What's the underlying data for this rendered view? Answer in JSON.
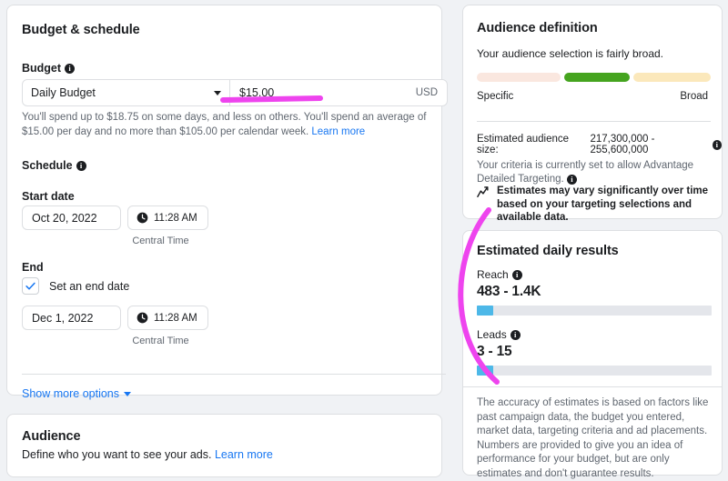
{
  "budget_card": {
    "title": "Budget & schedule",
    "budget_label": "Budget",
    "budget_type": "Daily Budget",
    "budget_amount": "$15.00",
    "currency": "USD",
    "help_text": "You'll spend up to $18.75 on some days, and less on others. You'll spend an average of $15.00 per day and no more than $105.00 per calendar week. ",
    "help_link": "Learn more",
    "schedule_label": "Schedule",
    "start_date_label": "Start date",
    "start_date": "Oct 20, 2022",
    "start_time": "11:28 AM",
    "start_timezone": "Central Time",
    "end_label": "End",
    "end_checkbox_label": "Set an end date",
    "end_checkbox_checked": true,
    "end_date": "Dec 1, 2022",
    "end_time": "11:28 AM",
    "end_timezone": "Central Time",
    "show_more_options": "Show more options"
  },
  "audience_card": {
    "title": "Audience",
    "subtitle": "Define who you want to see your ads. ",
    "link": "Learn more"
  },
  "audience_definition": {
    "title": "Audience definition",
    "subtitle": "Your audience selection is fairly broad.",
    "gauge_specific_label": "Specific",
    "gauge_broad_label": "Broad",
    "gauge_segments": [
      {
        "name": "specific",
        "color": "#fae7df",
        "width_pct": 37
      },
      {
        "name": "selected",
        "color": "#45a41f",
        "width_pct": 29
      },
      {
        "name": "broad",
        "color": "#fbe8bb",
        "width_pct": 34
      }
    ],
    "estimated_size_label": "Estimated audience size:",
    "estimated_size_value": "217,300,000 - 255,600,000",
    "criteria_note": "Your criteria is currently set to allow Advantage Detailed Targeting.",
    "estimates_note": "Estimates may vary significantly over time based on your targeting selections and available data."
  },
  "estimated_results": {
    "title": "Estimated daily results",
    "metrics": [
      {
        "label": "Reach",
        "value": "483 - 1.4K",
        "bar_pct": 7
      },
      {
        "label": "Leads",
        "value": "3 - 15",
        "bar_pct": 7
      }
    ],
    "note": "The accuracy of estimates is based on factors like past campaign data, the budget you entered, market data, targeting criteria and ad placements. Numbers are provided to give you an idea of performance for your budget, but are only estimates and don't guarantee results."
  },
  "annotations": {
    "highlight_color": "#ee44ee",
    "items": [
      {
        "name": "budget-amount-underline",
        "type": "line"
      },
      {
        "name": "estimated-results-arc",
        "type": "arc"
      }
    ]
  },
  "colors": {
    "link": "#1877f2",
    "bar_fill": "#4db8e8",
    "bar_track": "#e4e6eb",
    "page_bg": "#f0f2f5"
  }
}
